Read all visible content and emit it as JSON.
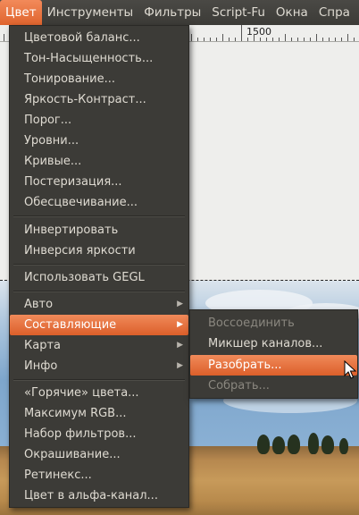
{
  "menubar": {
    "items": [
      "Цвет",
      "Инструменты",
      "Фильтры",
      "Script-Fu",
      "Окна",
      "Спра"
    ]
  },
  "ruler": {
    "label": "1500"
  },
  "color_menu": {
    "items": [
      "Цветовой баланс...",
      "Тон-Насыщенность...",
      "Тонирование...",
      "Яркость-Контраст...",
      "Порог...",
      "Уровни...",
      "Кривые...",
      "Постеризация...",
      "Обесцвечивание...",
      "Инвертировать",
      "Инверсия яркости",
      "Использовать GEGL",
      "Авто",
      "Составляющие",
      "Карта",
      "Инфо",
      "«Горячие» цвета...",
      "Максимум RGB...",
      "Набор фильтров...",
      "Окрашивание...",
      "Ретинекс...",
      "Цвет в альфа-канал..."
    ]
  },
  "components_submenu": {
    "items": [
      "Воссоединить",
      "Микшер каналов...",
      "Разобрать...",
      "Собрать..."
    ]
  },
  "colors": {
    "accent": "#e8703a",
    "menu_bg": "#3c3b37",
    "menu_text": "#dfdbd2",
    "disabled_text": "#8a877f"
  },
  "icons": {
    "submenu_arrow": "triangle-right-icon",
    "cursor": "mouse-pointer-icon"
  }
}
